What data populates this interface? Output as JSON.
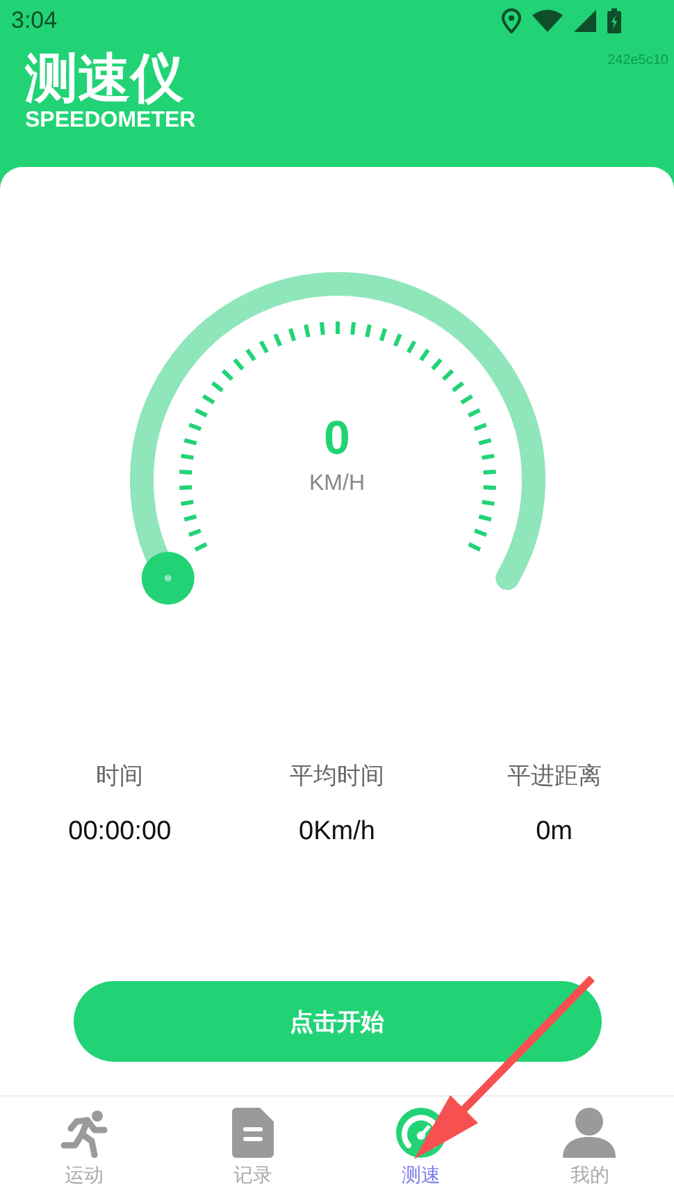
{
  "status_bar": {
    "time": "3:04"
  },
  "header": {
    "title": "测速仪",
    "subtitle": "SPEEDOMETER",
    "build_id": "242e5c10"
  },
  "gauge": {
    "speed": "0",
    "unit": "KM/H"
  },
  "stats": [
    {
      "label": "时间",
      "value": "00:00:00"
    },
    {
      "label": "平均时间",
      "value": "0Km/h"
    },
    {
      "label": "平进距离",
      "value": "0m"
    }
  ],
  "start_button": "点击开始",
  "tabs": [
    {
      "kind": "runner",
      "label": "运动",
      "selected": false
    },
    {
      "kind": "document",
      "label": "记录",
      "selected": false
    },
    {
      "kind": "gauge",
      "label": "测速",
      "selected": true
    },
    {
      "kind": "person",
      "label": "我的",
      "selected": false
    }
  ]
}
